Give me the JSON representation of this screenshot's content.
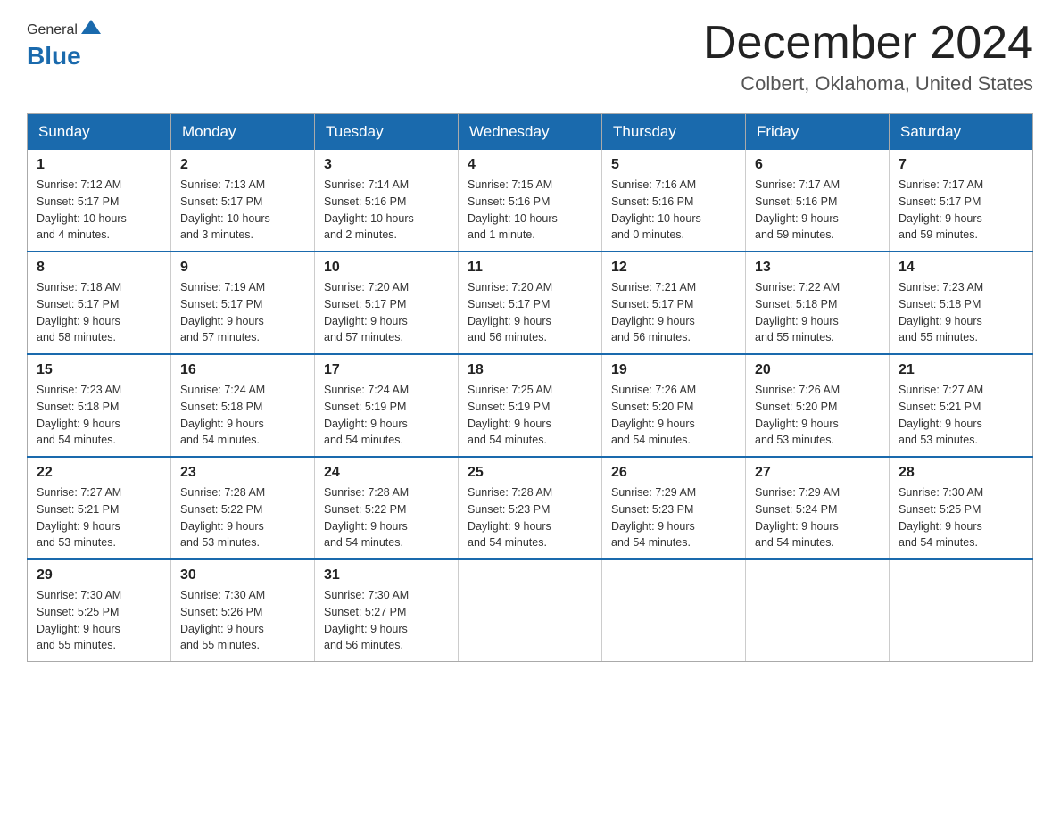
{
  "header": {
    "title": "December 2024",
    "subtitle": "Colbert, Oklahoma, United States",
    "logo_general": "General",
    "logo_blue": "Blue"
  },
  "days_of_week": [
    "Sunday",
    "Monday",
    "Tuesday",
    "Wednesday",
    "Thursday",
    "Friday",
    "Saturday"
  ],
  "weeks": [
    [
      {
        "day": "1",
        "sunrise": "7:12 AM",
        "sunset": "5:17 PM",
        "daylight": "10 hours and 4 minutes."
      },
      {
        "day": "2",
        "sunrise": "7:13 AM",
        "sunset": "5:17 PM",
        "daylight": "10 hours and 3 minutes."
      },
      {
        "day": "3",
        "sunrise": "7:14 AM",
        "sunset": "5:16 PM",
        "daylight": "10 hours and 2 minutes."
      },
      {
        "day": "4",
        "sunrise": "7:15 AM",
        "sunset": "5:16 PM",
        "daylight": "10 hours and 1 minute."
      },
      {
        "day": "5",
        "sunrise": "7:16 AM",
        "sunset": "5:16 PM",
        "daylight": "10 hours and 0 minutes."
      },
      {
        "day": "6",
        "sunrise": "7:17 AM",
        "sunset": "5:16 PM",
        "daylight": "9 hours and 59 minutes."
      },
      {
        "day": "7",
        "sunrise": "7:17 AM",
        "sunset": "5:17 PM",
        "daylight": "9 hours and 59 minutes."
      }
    ],
    [
      {
        "day": "8",
        "sunrise": "7:18 AM",
        "sunset": "5:17 PM",
        "daylight": "9 hours and 58 minutes."
      },
      {
        "day": "9",
        "sunrise": "7:19 AM",
        "sunset": "5:17 PM",
        "daylight": "9 hours and 57 minutes."
      },
      {
        "day": "10",
        "sunrise": "7:20 AM",
        "sunset": "5:17 PM",
        "daylight": "9 hours and 57 minutes."
      },
      {
        "day": "11",
        "sunrise": "7:20 AM",
        "sunset": "5:17 PM",
        "daylight": "9 hours and 56 minutes."
      },
      {
        "day": "12",
        "sunrise": "7:21 AM",
        "sunset": "5:17 PM",
        "daylight": "9 hours and 56 minutes."
      },
      {
        "day": "13",
        "sunrise": "7:22 AM",
        "sunset": "5:18 PM",
        "daylight": "9 hours and 55 minutes."
      },
      {
        "day": "14",
        "sunrise": "7:23 AM",
        "sunset": "5:18 PM",
        "daylight": "9 hours and 55 minutes."
      }
    ],
    [
      {
        "day": "15",
        "sunrise": "7:23 AM",
        "sunset": "5:18 PM",
        "daylight": "9 hours and 54 minutes."
      },
      {
        "day": "16",
        "sunrise": "7:24 AM",
        "sunset": "5:18 PM",
        "daylight": "9 hours and 54 minutes."
      },
      {
        "day": "17",
        "sunrise": "7:24 AM",
        "sunset": "5:19 PM",
        "daylight": "9 hours and 54 minutes."
      },
      {
        "day": "18",
        "sunrise": "7:25 AM",
        "sunset": "5:19 PM",
        "daylight": "9 hours and 54 minutes."
      },
      {
        "day": "19",
        "sunrise": "7:26 AM",
        "sunset": "5:20 PM",
        "daylight": "9 hours and 54 minutes."
      },
      {
        "day": "20",
        "sunrise": "7:26 AM",
        "sunset": "5:20 PM",
        "daylight": "9 hours and 53 minutes."
      },
      {
        "day": "21",
        "sunrise": "7:27 AM",
        "sunset": "5:21 PM",
        "daylight": "9 hours and 53 minutes."
      }
    ],
    [
      {
        "day": "22",
        "sunrise": "7:27 AM",
        "sunset": "5:21 PM",
        "daylight": "9 hours and 53 minutes."
      },
      {
        "day": "23",
        "sunrise": "7:28 AM",
        "sunset": "5:22 PM",
        "daylight": "9 hours and 53 minutes."
      },
      {
        "day": "24",
        "sunrise": "7:28 AM",
        "sunset": "5:22 PM",
        "daylight": "9 hours and 54 minutes."
      },
      {
        "day": "25",
        "sunrise": "7:28 AM",
        "sunset": "5:23 PM",
        "daylight": "9 hours and 54 minutes."
      },
      {
        "day": "26",
        "sunrise": "7:29 AM",
        "sunset": "5:23 PM",
        "daylight": "9 hours and 54 minutes."
      },
      {
        "day": "27",
        "sunrise": "7:29 AM",
        "sunset": "5:24 PM",
        "daylight": "9 hours and 54 minutes."
      },
      {
        "day": "28",
        "sunrise": "7:30 AM",
        "sunset": "5:25 PM",
        "daylight": "9 hours and 54 minutes."
      }
    ],
    [
      {
        "day": "29",
        "sunrise": "7:30 AM",
        "sunset": "5:25 PM",
        "daylight": "9 hours and 55 minutes."
      },
      {
        "day": "30",
        "sunrise": "7:30 AM",
        "sunset": "5:26 PM",
        "daylight": "9 hours and 55 minutes."
      },
      {
        "day": "31",
        "sunrise": "7:30 AM",
        "sunset": "5:27 PM",
        "daylight": "9 hours and 56 minutes."
      },
      null,
      null,
      null,
      null
    ]
  ],
  "labels": {
    "sunrise": "Sunrise:",
    "sunset": "Sunset:",
    "daylight": "Daylight:"
  }
}
